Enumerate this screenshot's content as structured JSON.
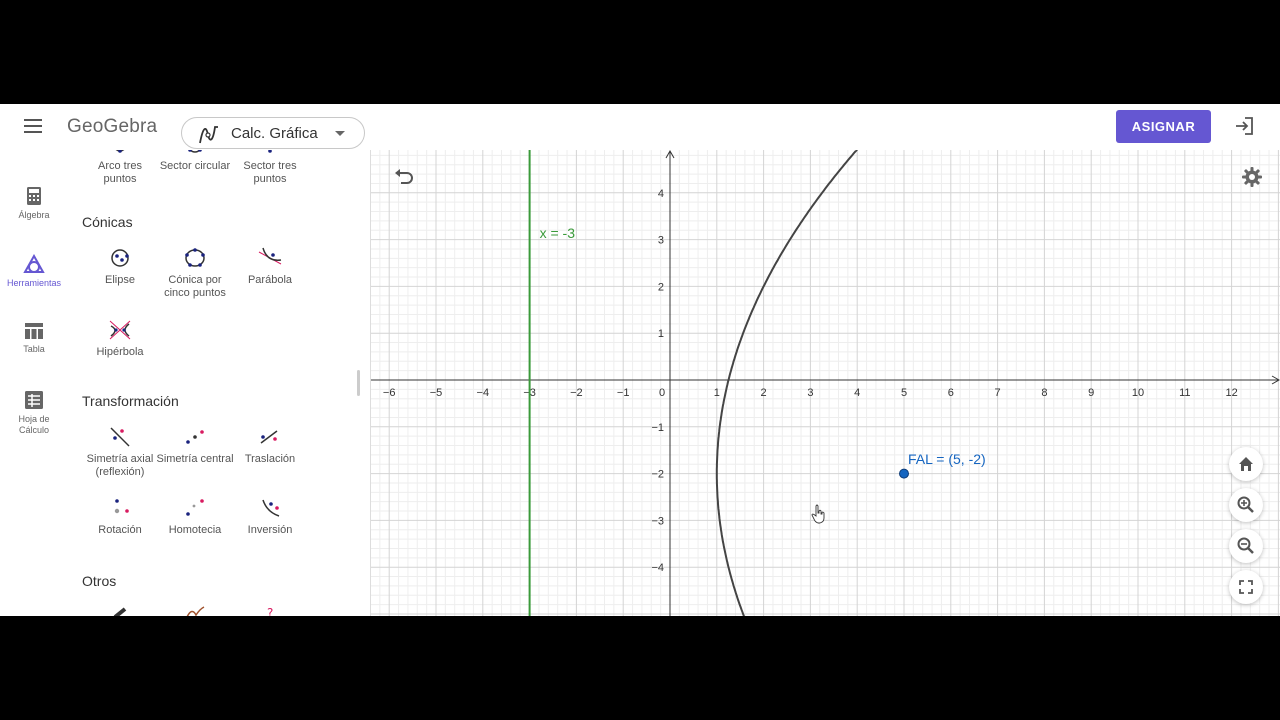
{
  "header": {
    "logo": "GeoGebra",
    "app_name": "Calc. Gráfica",
    "assign_label": "ASIGNAR",
    "brand_color": "#6557d2"
  },
  "rail": {
    "items": [
      {
        "label": "Álgebra",
        "icon": "calculator-icon"
      },
      {
        "label": "Herramientas",
        "icon": "tools-icon",
        "active": true
      },
      {
        "label": "Tabla",
        "icon": "table-icon"
      },
      {
        "label": "Hoja de Cálculo",
        "icon": "spreadsheet-icon"
      }
    ]
  },
  "tools": {
    "partial_row": [
      "Arco tres puntos",
      "Sector circular",
      "Sector tres puntos"
    ],
    "conicas": {
      "title": "Cónicas",
      "items": [
        "Elipse",
        "Cónica por cinco puntos",
        "Parábola",
        "Hipérbola"
      ]
    },
    "transformacion": {
      "title": "Transformación",
      "items": [
        "Simetría axial (reflexión)",
        "Simetría central",
        "Traslación",
        "Rotación",
        "Homotecia",
        "Inversión"
      ]
    },
    "otros": {
      "title": "Otros"
    }
  },
  "graph": {
    "line_label": "x = -3",
    "point_label": "FAL = (5, -2)",
    "line_color": "#3a9a3a",
    "point_color": "#1565c0",
    "curve_color": "#444444",
    "x_range": [
      -6.5,
      12.9
    ],
    "y_range": [
      -4.9,
      5.0
    ],
    "x_ticks": [
      -6,
      -5,
      -4,
      -3,
      -2,
      -1,
      0,
      1,
      2,
      3,
      4,
      5,
      6,
      7,
      8,
      9,
      10,
      11,
      12
    ],
    "y_ticks": [
      4,
      3,
      2,
      1,
      -1,
      -2,
      -3,
      -4
    ],
    "directrix_x": -3,
    "focus": [
      5,
      -2
    ]
  }
}
